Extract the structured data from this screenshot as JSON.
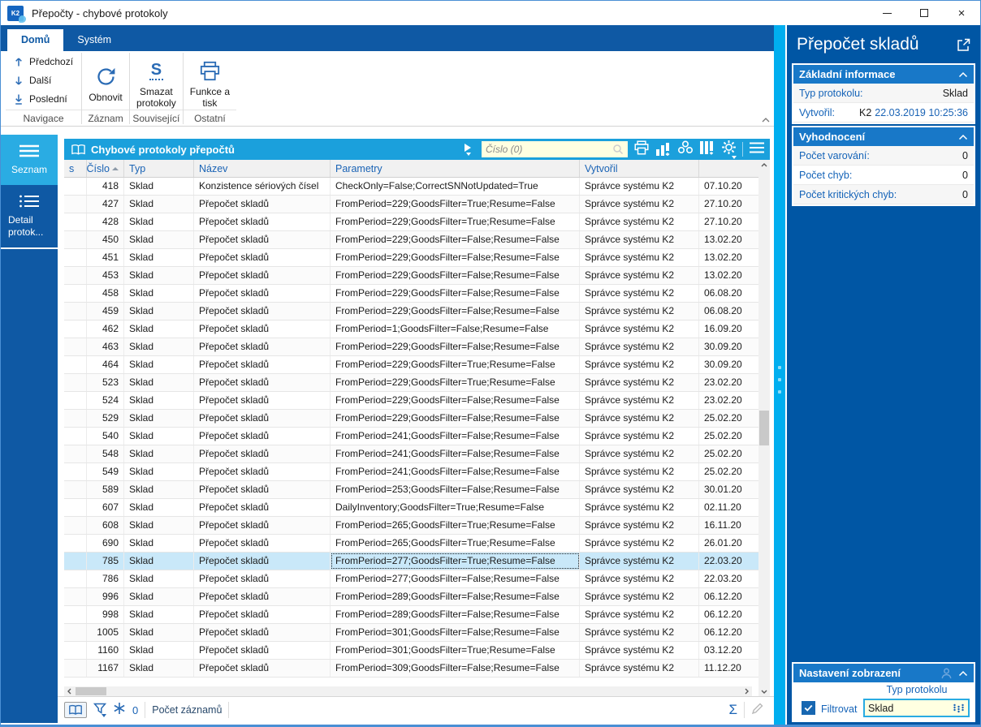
{
  "window": {
    "title": "Přepočty - chybové protokoly",
    "logo_text": "K2"
  },
  "ribbon": {
    "tabs": [
      {
        "label": "Domů",
        "active": true
      },
      {
        "label": "Systém",
        "active": false
      }
    ],
    "nav": {
      "items": [
        {
          "label": "Předchozí",
          "icon": "arrow-up"
        },
        {
          "label": "Další",
          "icon": "arrow-down"
        },
        {
          "label": "Poslední",
          "icon": "arrow-down-to-bar"
        }
      ],
      "group_label": "Navigace"
    },
    "record": {
      "button_label": "Obnovit",
      "group_label": "Záznam",
      "icon": "refresh"
    },
    "related": {
      "button_label": "Smazat\nprotokoly",
      "icon_letter": "S",
      "group_label": "Související"
    },
    "other": {
      "button_label": "Funkce a\ntisk",
      "group_label": "Ostatní",
      "icon": "printer"
    }
  },
  "sidebar": {
    "items": [
      {
        "label": "Seznam",
        "icon": "menu-icon",
        "active": true
      },
      {
        "label": "Detail\nprotok...",
        "icon": "detail-list-icon",
        "active": false
      }
    ]
  },
  "grid": {
    "caption": "Chybové protokoly přepočtů",
    "search_value": "Číslo (0)",
    "toolbar_icons": [
      "expand-play",
      "print",
      "chart",
      "related-records",
      "columns",
      "settings-gear",
      "menu"
    ],
    "columns": [
      "s",
      "Číslo",
      "Typ",
      "Název",
      "Parametry",
      "Vytvořil",
      ""
    ],
    "sorted_column": "Číslo",
    "selected_index": 21,
    "rows": [
      [
        "418",
        "Sklad",
        "Konzistence sériových čísel",
        "CheckOnly=False;CorrectSNNotUpdated=True",
        "Správce systému K2",
        "07.10.20"
      ],
      [
        "427",
        "Sklad",
        "Přepočet skladů",
        "FromPeriod=229;GoodsFilter=True;Resume=False",
        "Správce systému K2",
        "27.10.20"
      ],
      [
        "428",
        "Sklad",
        "Přepočet skladů",
        "FromPeriod=229;GoodsFilter=True;Resume=False",
        "Správce systému K2",
        "27.10.20"
      ],
      [
        "450",
        "Sklad",
        "Přepočet skladů",
        "FromPeriod=229;GoodsFilter=False;Resume=False",
        "Správce systému K2",
        "13.02.20"
      ],
      [
        "451",
        "Sklad",
        "Přepočet skladů",
        "FromPeriod=229;GoodsFilter=False;Resume=False",
        "Správce systému K2",
        "13.02.20"
      ],
      [
        "453",
        "Sklad",
        "Přepočet skladů",
        "FromPeriod=229;GoodsFilter=False;Resume=False",
        "Správce systému K2",
        "13.02.20"
      ],
      [
        "458",
        "Sklad",
        "Přepočet skladů",
        "FromPeriod=229;GoodsFilter=False;Resume=False",
        "Správce systému K2",
        "06.08.20"
      ],
      [
        "459",
        "Sklad",
        "Přepočet skladů",
        "FromPeriod=229;GoodsFilter=False;Resume=False",
        "Správce systému K2",
        "06.08.20"
      ],
      [
        "462",
        "Sklad",
        "Přepočet skladů",
        "FromPeriod=1;GoodsFilter=False;Resume=False",
        "Správce systému K2",
        "16.09.20"
      ],
      [
        "463",
        "Sklad",
        "Přepočet skladů",
        "FromPeriod=229;GoodsFilter=False;Resume=False",
        "Správce systému K2",
        "30.09.20"
      ],
      [
        "464",
        "Sklad",
        "Přepočet skladů",
        "FromPeriod=229;GoodsFilter=True;Resume=False",
        "Správce systému K2",
        "30.09.20"
      ],
      [
        "523",
        "Sklad",
        "Přepočet skladů",
        "FromPeriod=229;GoodsFilter=True;Resume=False",
        "Správce systému K2",
        "23.02.20"
      ],
      [
        "524",
        "Sklad",
        "Přepočet skladů",
        "FromPeriod=229;GoodsFilter=False;Resume=False",
        "Správce systému K2",
        "23.02.20"
      ],
      [
        "529",
        "Sklad",
        "Přepočet skladů",
        "FromPeriod=229;GoodsFilter=False;Resume=False",
        "Správce systému K2",
        "25.02.20"
      ],
      [
        "540",
        "Sklad",
        "Přepočet skladů",
        "FromPeriod=241;GoodsFilter=False;Resume=False",
        "Správce systému K2",
        "25.02.20"
      ],
      [
        "548",
        "Sklad",
        "Přepočet skladů",
        "FromPeriod=241;GoodsFilter=False;Resume=False",
        "Správce systému K2",
        "25.02.20"
      ],
      [
        "549",
        "Sklad",
        "Přepočet skladů",
        "FromPeriod=241;GoodsFilter=False;Resume=False",
        "Správce systému K2",
        "25.02.20"
      ],
      [
        "589",
        "Sklad",
        "Přepočet skladů",
        "FromPeriod=253;GoodsFilter=False;Resume=False",
        "Správce systému K2",
        "30.01.20"
      ],
      [
        "607",
        "Sklad",
        "Přepočet skladů",
        "DailyInventory;GoodsFilter=True;Resume=False",
        "Správce systému K2",
        "02.11.20"
      ],
      [
        "608",
        "Sklad",
        "Přepočet skladů",
        "FromPeriod=265;GoodsFilter=True;Resume=False",
        "Správce systému K2",
        "16.11.20"
      ],
      [
        "690",
        "Sklad",
        "Přepočet skladů",
        "FromPeriod=265;GoodsFilter=True;Resume=False",
        "Správce systému K2",
        "26.01.20"
      ],
      [
        "785",
        "Sklad",
        "Přepočet skladů",
        "FromPeriod=277;GoodsFilter=True;Resume=False",
        "Správce systému K2",
        "22.03.20"
      ],
      [
        "786",
        "Sklad",
        "Přepočet skladů",
        "FromPeriod=277;GoodsFilter=False;Resume=False",
        "Správce systému K2",
        "22.03.20"
      ],
      [
        "996",
        "Sklad",
        "Přepočet skladů",
        "FromPeriod=289;GoodsFilter=False;Resume=False",
        "Správce systému K2",
        "06.12.20"
      ],
      [
        "998",
        "Sklad",
        "Přepočet skladů",
        "FromPeriod=289;GoodsFilter=False;Resume=False",
        "Správce systému K2",
        "06.12.20"
      ],
      [
        "1005",
        "Sklad",
        "Přepočet skladů",
        "FromPeriod=301;GoodsFilter=False;Resume=False",
        "Správce systému K2",
        "06.12.20"
      ],
      [
        "1160",
        "Sklad",
        "Přepočet skladů",
        "FromPeriod=301;GoodsFilter=True;Resume=False",
        "Správce systému K2",
        "03.12.20"
      ],
      [
        "1167",
        "Sklad",
        "Přepočet skladů",
        "FromPeriod=309;GoodsFilter=False;Resume=False",
        "Správce systému K2",
        "11.12.20"
      ]
    ]
  },
  "statusbar": {
    "snowflake_count": "0",
    "records_label": "Počet záznamů",
    "sum_symbol": "Σ"
  },
  "side_panel": {
    "title": "Přepočet skladů",
    "basic": {
      "title": "Základní informace",
      "rows": [
        {
          "label": "Typ protokolu:",
          "value": "Sklad"
        },
        {
          "label": "Vytvořil:",
          "value_user": "K2",
          "value_date": "22.03.2019 10:25:36"
        }
      ]
    },
    "evaluation": {
      "title": "Vyhodnocení",
      "rows": [
        {
          "label": "Počet varování:",
          "value": "0"
        },
        {
          "label": "Počet chyb:",
          "value": "0"
        },
        {
          "label": "Počet kritických chyb:",
          "value": "0"
        }
      ]
    },
    "display": {
      "title": "Nastavení zobrazení",
      "field_label": "Typ protokolu",
      "checkbox_label": "Filtrovat",
      "checkbox_checked": true,
      "dropdown_value": "Sklad"
    }
  },
  "colors": {
    "accent_cyan": "#00aeef",
    "ribbon_blue": "#0f59a4",
    "grid_caption_blue": "#1ba0dc",
    "panel_blue": "#0056a4",
    "section_header_blue": "#1878c8",
    "selection_row": "#c9e8f9",
    "input_cream": "#ffffe1",
    "label_blue": "#1463b8"
  }
}
